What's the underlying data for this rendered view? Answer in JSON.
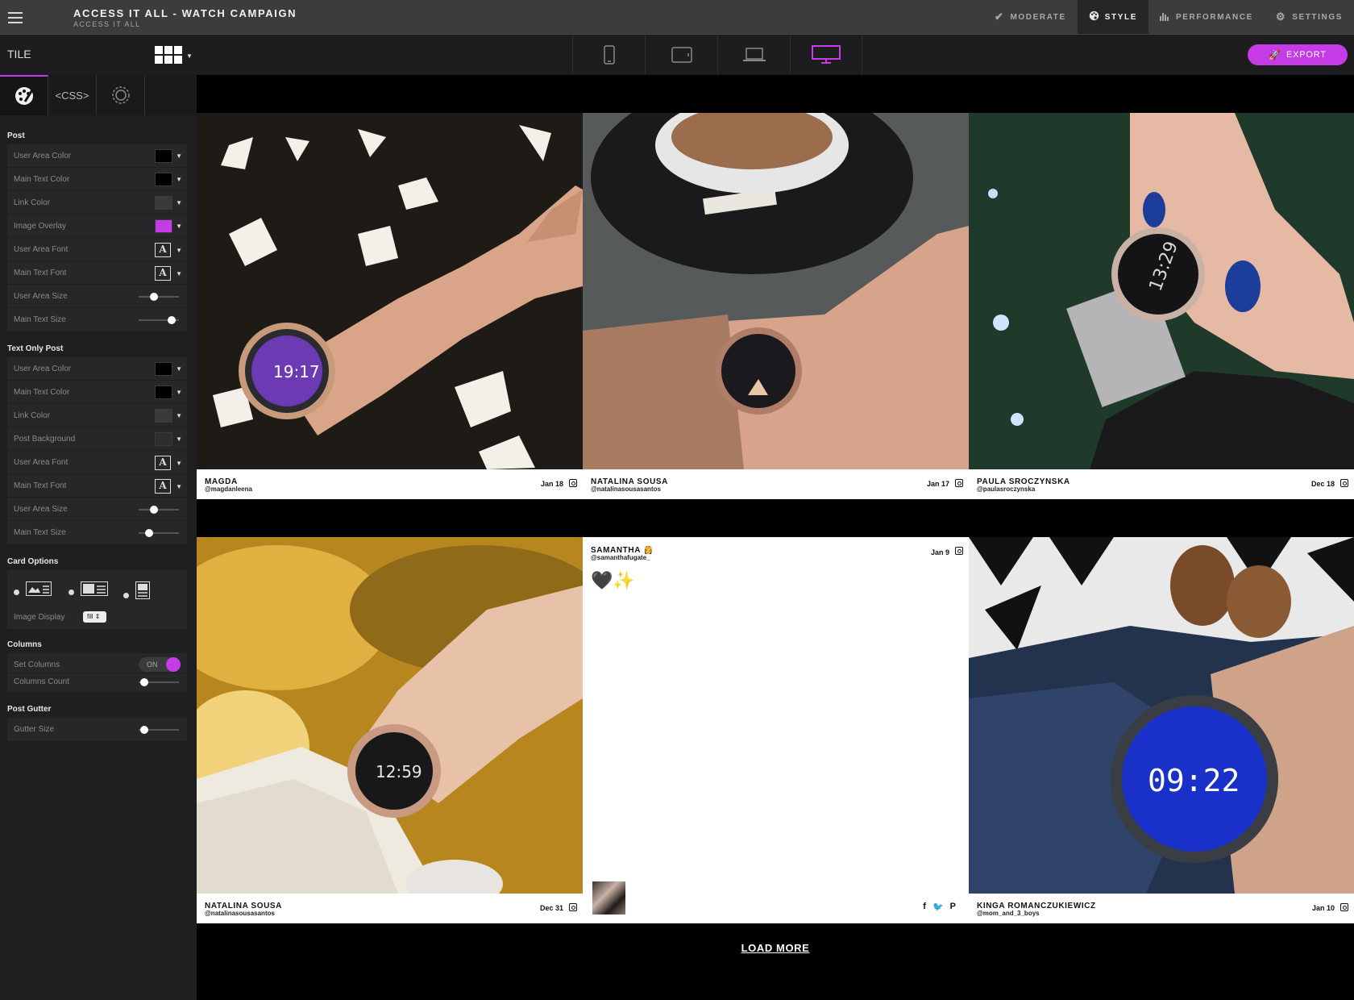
{
  "header": {
    "title": "ACCESS IT ALL - WATCH CAMPAIGN",
    "subtitle": "ACCESS IT ALL",
    "nav": [
      {
        "label": "MODERATE",
        "icon": "check-icon",
        "active": false
      },
      {
        "label": "STYLE",
        "icon": "palette-icon",
        "active": true
      },
      {
        "label": "PERFORMANCE",
        "icon": "bar-chart-icon",
        "active": false
      },
      {
        "label": "SETTINGS",
        "icon": "gear-icon",
        "active": false
      }
    ]
  },
  "toolbar": {
    "layout_label": "TILE",
    "devices": [
      "phone-icon",
      "tablet-icon",
      "laptop-icon",
      "desktop-icon"
    ],
    "active_device": "desktop-icon",
    "export_label": "EXPORT"
  },
  "sidebar": {
    "tabs": [
      {
        "label": "",
        "icon": "palette-brush-icon",
        "active": true
      },
      {
        "label": "<CSS>",
        "icon": "",
        "active": false
      },
      {
        "label": "",
        "icon": "gear-icon",
        "active": false
      }
    ],
    "post": {
      "title": "Post",
      "user_area_color": "User Area Color",
      "main_text_color": "Main Text Color",
      "link_color": "Link Color",
      "image_overlay": "Image Overlay",
      "user_area_font": "User Area Font",
      "main_text_font": "Main Text Font",
      "user_area_size": "User Area Size",
      "main_text_size": "Main Text Size",
      "user_area_size_level": 0.35,
      "main_text_size_level": 0.9
    },
    "text_only_post": {
      "title": "Text Only Post",
      "user_area_color": "User Area Color",
      "main_text_color": "Main Text Color",
      "link_color": "Link Color",
      "post_background": "Post Background",
      "user_area_font": "User Area Font",
      "main_text_font": "Main Text Font",
      "user_area_size": "User Area Size",
      "main_text_size": "Main Text Size",
      "user_area_size_level": 0.35,
      "main_text_size_level": 0.2
    },
    "card_options": {
      "title": "Card Options",
      "image_display_label": "Image Display",
      "image_display_value": "fill ⇕"
    },
    "columns": {
      "title": "Columns",
      "set_columns_label": "Set Columns",
      "set_columns_value": "ON",
      "columns_count_label": "Columns Count",
      "columns_count_level": 0.05
    },
    "post_gutter": {
      "title": "Post Gutter",
      "gutter_size_label": "Gutter Size",
      "gutter_size_level": 0.05
    },
    "colors": {
      "black": "#000000",
      "gray": "#3a3a3c",
      "overlay": "#c53be6",
      "accent": "#c53be6"
    }
  },
  "feed": {
    "posts": [
      {
        "name": "MAGDA",
        "handle": "@magdanleena",
        "date": "Jan 18"
      },
      {
        "name": "NATALINA SOUSA",
        "handle": "@natalinasousasantos",
        "date": "Jan 17"
      },
      {
        "name": "PAULA SROCZYNSKA",
        "handle": "@paulasroczynska",
        "date": "Dec 18"
      },
      {
        "name": "NATALINA SOUSA",
        "handle": "@natalinasousasantos",
        "date": "Dec 31"
      },
      {
        "name": "SAMANTHA 👸",
        "handle": "@samanthafugate_",
        "date": "Jan 9",
        "text": "🖤✨"
      },
      {
        "name": "KINGA ROMANCZUKIEWICZ",
        "handle": "@mom_and_3_boys",
        "date": "Jan 10"
      }
    ],
    "load_more": "LOAD MORE"
  }
}
